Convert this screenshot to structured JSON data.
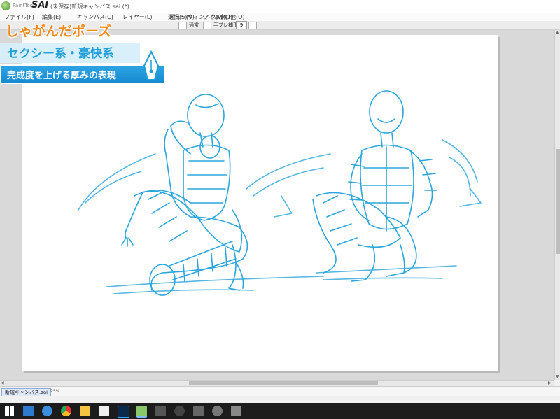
{
  "window": {
    "app_small_label": "PaintTool",
    "app_name": "SAI",
    "doc_title": "(未保存)新規キャンバス.sai (*)"
  },
  "menu": {
    "items": [
      "ファイル(F)",
      "編集(E)",
      "キャンバス(C)",
      "レイヤー(L)",
      "選択(S)",
      "フィルタ(T)",
      "ビュー(V)",
      "ウィンドウ(W)",
      "その他(O)"
    ]
  },
  "toolbar": {
    "mode_label": "通常",
    "stabilizer_label": "手ブレ補正",
    "stabilizer_value": "9"
  },
  "overlay": {
    "title": "しゃがんだポーズ",
    "subtitle": "セクシー系・豪快系",
    "caption": "完成度を上げる厚みの表現"
  },
  "file_tab": {
    "name": "新規キャンバス.sai",
    "zoom": "25%"
  },
  "taskbar": {
    "icons": [
      "windows-start-icon",
      "edge-icon",
      "chrome-icon",
      "file-explorer-icon",
      "store-icon",
      "photoshop-icon",
      "sai-icon",
      "app-icon",
      "app-icon-2",
      "app-icon-3",
      "app-icon-4",
      "app-icon-5"
    ]
  },
  "colors": {
    "sketch": "#2aa6dc",
    "title_orange": "#f08a1c",
    "accent_blue": "#1f9fd8",
    "caption_bg": "#178ad0"
  }
}
